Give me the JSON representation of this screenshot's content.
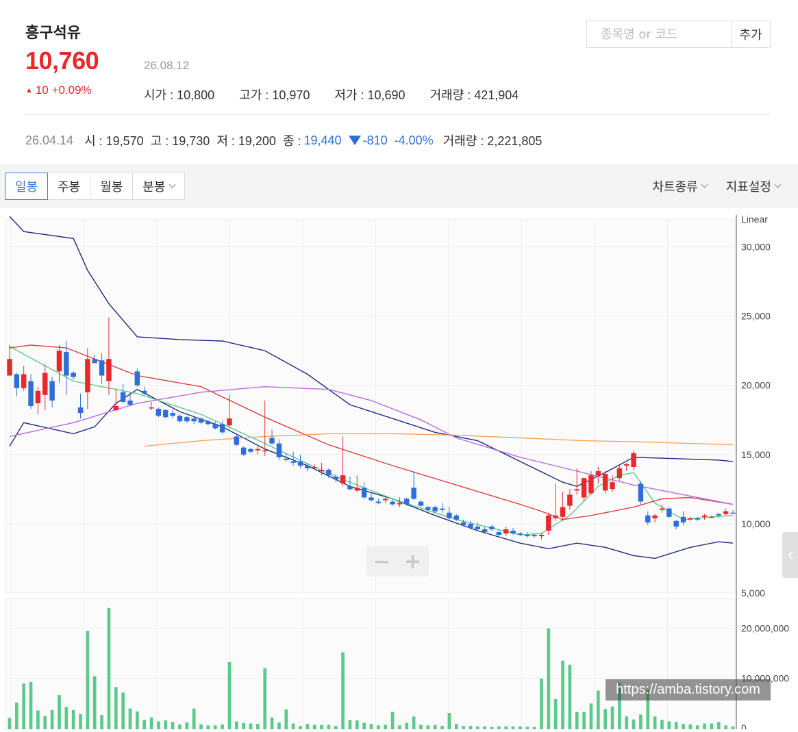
{
  "stock": {
    "name": "흥구석유",
    "price": "10,760",
    "date": "26.08.12",
    "change": "10 +0.09%",
    "open": "시가 : 10,800",
    "high": "고가 : 10,970",
    "low": "저가 : 10,690",
    "volume": "거래량 : 421,904"
  },
  "search": {
    "placeholder": "종목명 or 코드",
    "button": "추가"
  },
  "prev": {
    "date": "26.04.14",
    "open": "시 : 19,570",
    "high": "고 : 19,730",
    "low": "저 : 19,200",
    "close_label": "종 :",
    "close_value": "19,440",
    "change": "-810",
    "change_pct": "-4.00%",
    "volume": "거래량 : 2,221,805"
  },
  "tabs": [
    "일봉",
    "주봉",
    "월봉",
    "분봉"
  ],
  "menus": [
    "차트종류",
    "지표설정"
  ],
  "colors": {
    "up": "#e8282b",
    "down": "#2d6fd6",
    "accent": "#3a7bd5",
    "volume": "#5cc98a"
  },
  "zoom": {
    "minus": "−",
    "plus": "+"
  },
  "watermark": "https://amba.tistory.com",
  "chart_data": [
    {
      "type": "candlestick",
      "scale_label": "Linear",
      "ylim": [
        5000,
        32000
      ],
      "yticks": [
        "30,000",
        "25,000",
        "20,000",
        "15,000",
        "10,000",
        "5,000"
      ],
      "candles": [
        [
          20700,
          22900,
          20900,
          21900
        ],
        [
          20800,
          20900,
          19200,
          19800
        ],
        [
          19800,
          21400,
          19600,
          20800
        ],
        [
          20300,
          20800,
          18300,
          18500
        ],
        [
          18700,
          19900,
          17900,
          19600
        ],
        [
          19300,
          21500,
          18200,
          20900
        ],
        [
          20300,
          20600,
          18400,
          18900
        ],
        [
          21000,
          22900,
          20200,
          22500
        ],
        [
          22400,
          23200,
          19300,
          20700
        ],
        [
          20900,
          21000,
          20400,
          20600
        ],
        [
          18400,
          19400,
          17600,
          18000
        ],
        [
          19500,
          22700,
          18300,
          21900
        ],
        [
          21900,
          22200,
          21600,
          21600
        ],
        [
          21800,
          22300,
          20100,
          20700
        ],
        [
          20300,
          24900,
          19300,
          21900
        ],
        [
          18200,
          19800,
          18100,
          18500
        ],
        [
          19500,
          20100,
          18700,
          18800
        ],
        [
          18900,
          19500,
          18500,
          18600
        ],
        [
          21000,
          21200,
          19900,
          20000
        ],
        [
          19600,
          19900,
          19300,
          19400
        ],
        [
          18400,
          18800,
          18200,
          18400
        ],
        [
          18300,
          18400,
          17700,
          17800
        ],
        [
          18200,
          18300,
          17600,
          17700
        ],
        [
          18000,
          18200,
          17600,
          17800
        ],
        [
          17800,
          17900,
          17300,
          17400
        ],
        [
          17700,
          17800,
          17300,
          17400
        ],
        [
          17600,
          17700,
          17200,
          17400
        ],
        [
          17600,
          17700,
          17200,
          17300
        ],
        [
          17400,
          17500,
          17100,
          17200
        ],
        [
          17200,
          17400,
          16800,
          16900
        ],
        [
          17200,
          17400,
          16500,
          16600
        ],
        [
          17100,
          19300,
          16900,
          17600
        ],
        [
          16300,
          16400,
          15600,
          15700
        ],
        [
          15500,
          15600,
          14900,
          15000
        ],
        [
          15400,
          15500,
          15100,
          15200
        ],
        [
          15300,
          15600,
          15000,
          15400
        ],
        [
          15300,
          18900,
          14900,
          15300
        ],
        [
          16200,
          16800,
          15700,
          15800
        ],
        [
          15800,
          16100,
          14600,
          14800
        ],
        [
          14700,
          15100,
          14500,
          14600
        ],
        [
          14500,
          15200,
          14200,
          14400
        ],
        [
          14500,
          15000,
          14000,
          14200
        ],
        [
          14200,
          14400,
          13800,
          14000
        ],
        [
          14100,
          14300,
          13900,
          14100
        ],
        [
          13800,
          14400,
          13500,
          13900
        ],
        [
          13900,
          14000,
          13300,
          13500
        ],
        [
          13400,
          13600,
          13000,
          13200
        ],
        [
          12900,
          16300,
          12700,
          13500
        ],
        [
          12700,
          13400,
          12400,
          12500
        ],
        [
          12400,
          13500,
          12300,
          12600
        ],
        [
          12600,
          13000,
          11800,
          11900
        ],
        [
          11900,
          12200,
          11600,
          11700
        ],
        [
          11600,
          11800,
          11400,
          11500
        ],
        [
          11700,
          11900,
          11500,
          11800
        ],
        [
          11600,
          11800,
          11300,
          11400
        ],
        [
          11400,
          11900,
          11200,
          11500
        ],
        [
          11800,
          11900,
          11300,
          11400
        ],
        [
          12600,
          13800,
          11700,
          11800
        ],
        [
          11600,
          11700,
          11200,
          11300
        ],
        [
          11200,
          11300,
          10900,
          11000
        ],
        [
          11200,
          11300,
          10800,
          10900
        ],
        [
          11100,
          11500,
          10800,
          11000
        ],
        [
          10800,
          11200,
          10300,
          10400
        ],
        [
          10600,
          10700,
          10200,
          10300
        ],
        [
          10100,
          10300,
          9800,
          9900
        ],
        [
          10000,
          10200,
          9600,
          9700
        ],
        [
          9800,
          10100,
          9500,
          9600
        ],
        [
          9600,
          9800,
          9300,
          9400
        ],
        [
          9800,
          9900,
          9500,
          9600
        ],
        [
          9400,
          9600,
          9100,
          9200
        ],
        [
          9300,
          9800,
          9100,
          9600
        ],
        [
          9500,
          9700,
          9200,
          9300
        ],
        [
          9300,
          9400,
          9100,
          9200
        ],
        [
          9200,
          9400,
          9000,
          9100
        ],
        [
          9200,
          9300,
          9000,
          9100
        ],
        [
          9100,
          9300,
          8900,
          9200
        ],
        [
          9500,
          10800,
          9200,
          10600
        ],
        [
          10400,
          12900,
          10200,
          10600
        ],
        [
          10500,
          12300,
          10200,
          11200
        ],
        [
          11300,
          12500,
          11000,
          12100
        ],
        [
          12400,
          14000,
          12100,
          12500
        ],
        [
          11900,
          13300,
          11600,
          13300
        ],
        [
          12200,
          13800,
          12100,
          13500
        ],
        [
          13500,
          14100,
          12900,
          13800
        ],
        [
          12400,
          13800,
          12200,
          13600
        ],
        [
          12500,
          13500,
          12300,
          13000
        ],
        [
          13300,
          14200,
          13100,
          14000
        ],
        [
          14200,
          14400,
          13800,
          14300
        ],
        [
          14100,
          15300,
          13900,
          15100
        ],
        [
          12900,
          13100,
          11400,
          11600
        ],
        [
          10600,
          10900,
          9900,
          10100
        ],
        [
          10400,
          10700,
          10100,
          10600
        ],
        [
          11000,
          11400,
          10800,
          11100
        ],
        [
          11100,
          11200,
          10400,
          10500
        ],
        [
          10200,
          10300,
          9600,
          9800
        ],
        [
          10500,
          10900,
          9900,
          10100
        ],
        [
          10300,
          10500,
          10200,
          10400
        ],
        [
          10400,
          10500,
          10200,
          10300
        ],
        [
          10500,
          10700,
          10300,
          10600
        ],
        [
          10500,
          10600,
          10400,
          10500
        ],
        [
          10700,
          10800,
          10400,
          10600
        ],
        [
          10700,
          11100,
          10600,
          10900
        ],
        [
          10800,
          10970,
          10690,
          10760
        ]
      ],
      "moving_averages": {
        "ma5": [
          [
            0,
            22800
          ],
          [
            9,
            20300
          ],
          [
            18,
            19400
          ],
          [
            27,
            17900
          ],
          [
            36,
            15800
          ],
          [
            45,
            13600
          ],
          [
            54,
            11800
          ],
          [
            63,
            10300
          ],
          [
            72,
            9200
          ],
          [
            75,
            9300
          ],
          [
            79,
            10600
          ],
          [
            83,
            12700
          ],
          [
            86,
            13500
          ],
          [
            88,
            13700
          ],
          [
            91,
            11500
          ],
          [
            95,
            10300
          ],
          [
            99,
            10500
          ],
          [
            102,
            10600
          ]
        ],
        "ma20": [
          [
            0,
            22700
          ],
          [
            3,
            22900
          ],
          [
            8,
            22700
          ],
          [
            14,
            21500
          ],
          [
            18,
            20700
          ],
          [
            27,
            19900
          ],
          [
            36,
            17700
          ],
          [
            45,
            15700
          ],
          [
            54,
            14200
          ],
          [
            63,
            12800
          ],
          [
            72,
            11400
          ],
          [
            75,
            10900
          ],
          [
            78,
            10300
          ],
          [
            82,
            10600
          ],
          [
            88,
            11200
          ],
          [
            92,
            11800
          ],
          [
            96,
            11900
          ],
          [
            102,
            11400
          ]
        ],
        "ma60": [
          [
            0,
            16300
          ],
          [
            9,
            17300
          ],
          [
            18,
            18700
          ],
          [
            27,
            19500
          ],
          [
            36,
            19900
          ],
          [
            45,
            19700
          ],
          [
            51,
            18900
          ],
          [
            58,
            17500
          ],
          [
            63,
            16200
          ],
          [
            72,
            14800
          ],
          [
            80,
            13800
          ],
          [
            88,
            12800
          ],
          [
            96,
            12000
          ],
          [
            102,
            11400
          ]
        ],
        "ma120": [
          [
            19,
            15600
          ],
          [
            27,
            16000
          ],
          [
            36,
            16300
          ],
          [
            45,
            16500
          ],
          [
            54,
            16500
          ],
          [
            63,
            16400
          ],
          [
            72,
            16200
          ],
          [
            81,
            16000
          ],
          [
            90,
            15900
          ],
          [
            102,
            15700
          ]
        ]
      },
      "bollinger": {
        "upper": [
          [
            0,
            32200
          ],
          [
            2,
            31100
          ],
          [
            9,
            30600
          ],
          [
            11,
            28300
          ],
          [
            14,
            25900
          ],
          [
            18,
            23500
          ],
          [
            24,
            23300
          ],
          [
            30,
            23200
          ],
          [
            36,
            22500
          ],
          [
            42,
            20800
          ],
          [
            48,
            18600
          ],
          [
            54,
            17600
          ],
          [
            60,
            16600
          ],
          [
            66,
            16000
          ],
          [
            72,
            14500
          ],
          [
            78,
            13000
          ],
          [
            80,
            12700
          ],
          [
            84,
            13700
          ],
          [
            88,
            14800
          ],
          [
            94,
            14700
          ],
          [
            100,
            14600
          ],
          [
            102,
            14500
          ]
        ],
        "lower": [
          [
            0,
            15600
          ],
          [
            2,
            17300
          ],
          [
            9,
            16500
          ],
          [
            12,
            17000
          ],
          [
            15,
            18700
          ],
          [
            18,
            19700
          ],
          [
            24,
            18100
          ],
          [
            30,
            17000
          ],
          [
            36,
            15400
          ],
          [
            42,
            14200
          ],
          [
            48,
            12700
          ],
          [
            54,
            11800
          ],
          [
            60,
            10600
          ],
          [
            66,
            9500
          ],
          [
            72,
            8600
          ],
          [
            76,
            8200
          ],
          [
            80,
            8600
          ],
          [
            84,
            8300
          ],
          [
            88,
            7700
          ],
          [
            91,
            7500
          ],
          [
            96,
            8300
          ],
          [
            100,
            8700
          ],
          [
            102,
            8600
          ]
        ]
      }
    },
    {
      "type": "bar",
      "ylim": [
        0,
        26000000
      ],
      "yticks": [
        "20,000,000",
        "10,000,000",
        "0"
      ],
      "volumes": [
        2000000,
        5100000,
        8900000,
        9200000,
        3500000,
        2400000,
        3600000,
        6600000,
        4200000,
        3600000,
        2800000,
        19500000,
        10400000,
        2600000,
        24100000,
        8200000,
        7100000,
        3900000,
        3300000,
        1600000,
        2100000,
        1300000,
        1500000,
        1200000,
        700000,
        1100000,
        3900000,
        700000,
        500000,
        500000,
        700000,
        13200000,
        1300000,
        1000000,
        900000,
        800000,
        12000000,
        2100000,
        1100000,
        3700000,
        900000,
        400000,
        800000,
        600000,
        600000,
        600000,
        400000,
        15200000,
        1600000,
        1500000,
        1000000,
        800000,
        500000,
        600000,
        3200000,
        500000,
        1000000,
        2300000,
        600000,
        500000,
        600000,
        400000,
        3000000,
        800000,
        400000,
        400000,
        300000,
        300000,
        200000,
        300000,
        300000,
        300000,
        300000,
        200000,
        200000,
        9900000,
        20000000,
        5800000,
        13500000,
        12700000,
        3200000,
        3200000,
        4900000,
        7500000,
        3800000,
        4300000,
        9100000,
        2300000,
        1700000,
        2700000,
        7700000,
        2300000,
        1600000,
        1300000,
        1200000,
        800000,
        700000,
        500000,
        900000,
        900000,
        1200000,
        500000,
        300000
      ]
    }
  ]
}
